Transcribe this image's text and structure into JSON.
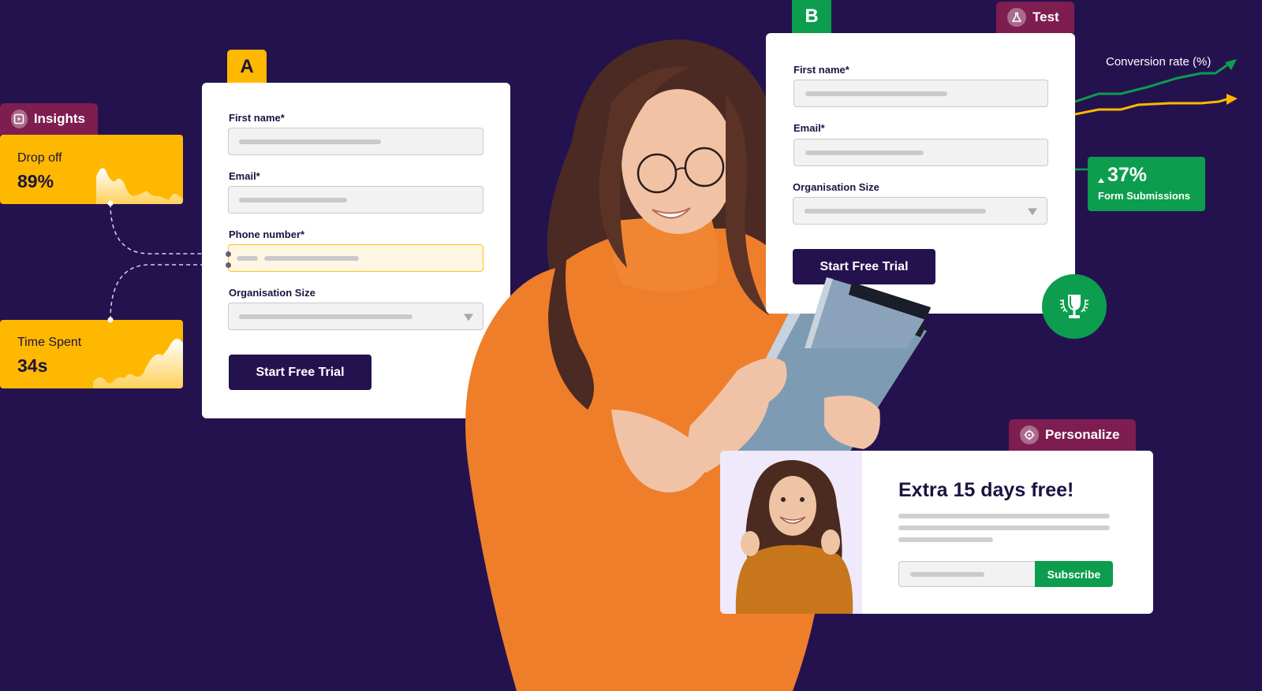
{
  "colors": {
    "background": "#24124f",
    "accent_yellow": "#ffb800",
    "accent_green": "#0c9d4e",
    "tag_magenta": "#7d1d50",
    "button_navy": "#24124f"
  },
  "insights": {
    "tag_label": "Insights",
    "tag_icon": "cursor-click-icon",
    "drop_off": {
      "label": "Drop off",
      "value": "89%"
    },
    "time_spent": {
      "label": "Time Spent",
      "value": "34s"
    }
  },
  "variant_a": {
    "letter": "A",
    "fields": [
      {
        "label": "First name*",
        "type": "text"
      },
      {
        "label": "Email*",
        "type": "text"
      },
      {
        "label": "Phone number*",
        "type": "text",
        "highlighted": true
      },
      {
        "label": "Organisation Size",
        "type": "select"
      }
    ],
    "submit_label": "Start Free Trial"
  },
  "variant_b": {
    "letter": "B",
    "fields": [
      {
        "label": "First name*",
        "type": "text"
      },
      {
        "label": "Email*",
        "type": "text"
      },
      {
        "label": "Organisation Size",
        "type": "select"
      }
    ],
    "submit_label": "Start Free Trial"
  },
  "test": {
    "tag_label": "Test",
    "tag_icon": "flask-icon"
  },
  "conversion": {
    "label": "Conversion rate (%)",
    "stat_value": "37%",
    "stat_label": "Form Submissions",
    "stat_icon": "up-arrow-icon"
  },
  "winner_icon": "trophy-icon",
  "personalize": {
    "tag_label": "Personalize",
    "tag_icon": "target-icon",
    "headline": "Extra 15 days free!",
    "subscribe_label": "Subscribe"
  }
}
